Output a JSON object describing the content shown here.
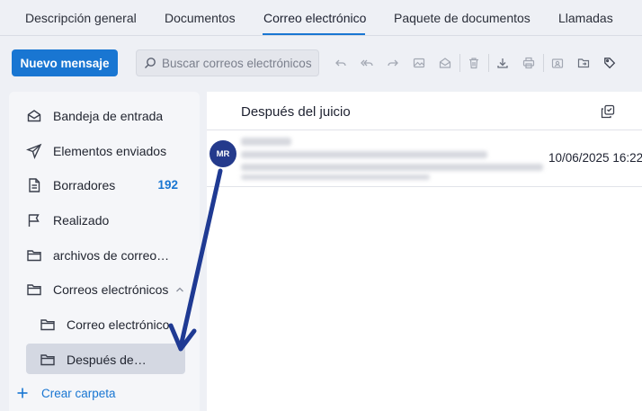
{
  "tabs": [
    {
      "label": "Descripción general",
      "active": false
    },
    {
      "label": "Documentos",
      "active": false
    },
    {
      "label": "Correo electrónico",
      "active": true
    },
    {
      "label": "Paquete de documentos",
      "active": false
    },
    {
      "label": "Llamadas",
      "active": false
    }
  ],
  "toolbar": {
    "new_message_label": "Nuevo mensaje",
    "search_placeholder": "Buscar correos electrónicos",
    "icons": [
      "reply-icon",
      "reply-all-icon",
      "forward-icon",
      "image-icon",
      "mark-read-icon",
      "delete-icon",
      "download-icon",
      "print-icon",
      "assign-icon",
      "move-folder-icon",
      "tag-icon"
    ]
  },
  "sidebar": {
    "items": [
      {
        "label": "Bandeja de entrada",
        "icon": "inbox-icon"
      },
      {
        "label": "Elementos enviados",
        "icon": "send-icon"
      },
      {
        "label": "Borradores",
        "icon": "draft-icon",
        "count": "192"
      },
      {
        "label": "Realizado",
        "icon": "flag-icon"
      },
      {
        "label": "archivos de correos electrónicos",
        "icon": "folder-icon"
      },
      {
        "label": "Correos electrónicos",
        "icon": "folder-icon",
        "expanded": true
      },
      {
        "label": "Correo electrónico",
        "icon": "folder-icon",
        "sub": true
      },
      {
        "label": "Después del juicio",
        "icon": "folder-icon",
        "sub": true,
        "selected": true
      }
    ],
    "create_folder_label": "Crear carpeta"
  },
  "thread": {
    "title": "Después del juicio",
    "messages": [
      {
        "avatar_initials": "MR",
        "date": "10/06/2025 16:22"
      }
    ]
  },
  "colors": {
    "accent": "#1976d2",
    "avatar": "#243a8c",
    "annotation_arrow": "#1f3a93"
  }
}
